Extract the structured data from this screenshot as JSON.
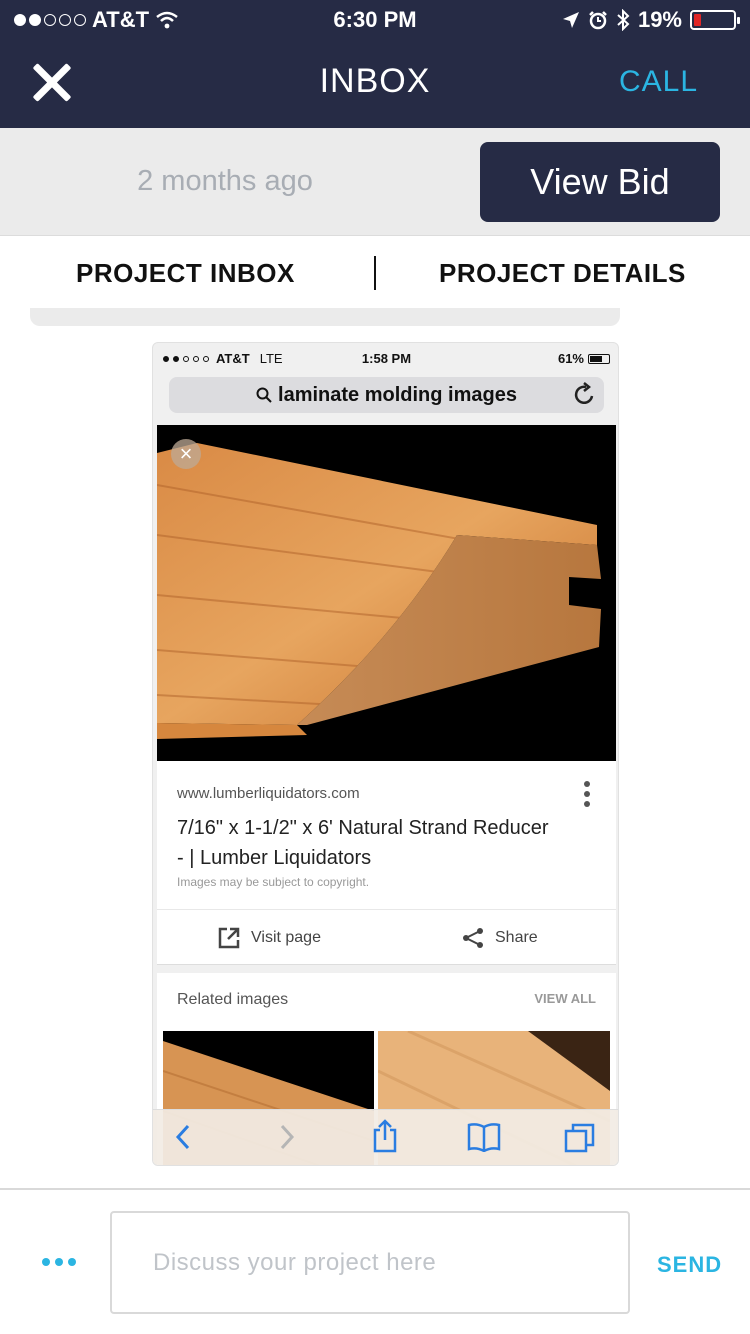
{
  "status_bar": {
    "carrier": "AT&T",
    "time": "6:30 PM",
    "battery": "19%",
    "battery_level": 0.19
  },
  "nav": {
    "title": "INBOX",
    "call_label": "CALL"
  },
  "message_meta": {
    "timestamp": "2 months ago",
    "view_bid_label": "View Bid"
  },
  "tabs": [
    {
      "label": "PROJECT INBOX"
    },
    {
      "label": "PROJECT DETAILS"
    }
  ],
  "attachment": {
    "status_bar": {
      "carrier": "AT&T",
      "network": "LTE",
      "time": "1:58 PM",
      "battery": "61%"
    },
    "search_query": "laminate molding images",
    "result": {
      "site": "www.lumberliquidators.com",
      "title": "7/16\" x 1-1/2\" x 6' Natural Strand Reducer - | Lumber Liquidators",
      "copyright_note": "Images may be subject to copyright.",
      "visit_label": "Visit page",
      "share_label": "Share"
    },
    "related": {
      "title": "Related images",
      "view_all_label": "VIEW ALL"
    },
    "toolbar_icons": [
      "back-icon",
      "forward-icon",
      "share-icon",
      "bookmarks-icon",
      "tabs-icon"
    ]
  },
  "composer": {
    "placeholder": "Discuss your project here",
    "send_label": "SEND"
  },
  "colors": {
    "navy": "#262b45",
    "accent": "#2bb5e2",
    "battery_low": "#e02626"
  }
}
